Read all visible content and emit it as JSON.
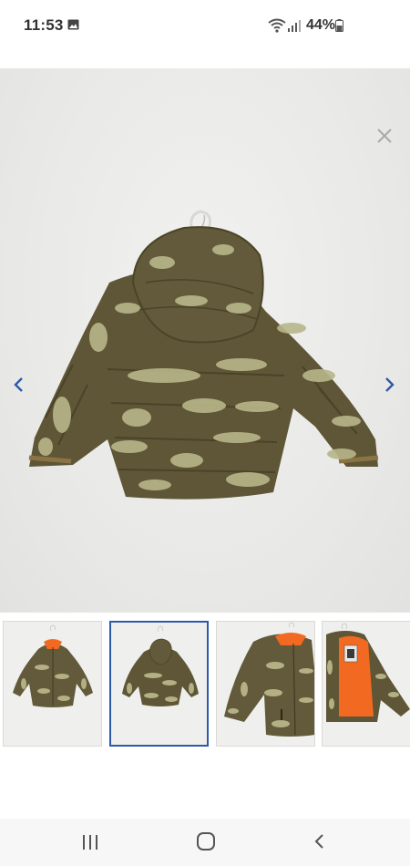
{
  "status_bar": {
    "time": "11:53",
    "battery": "44%",
    "icons": [
      "gallery-icon",
      "wifi-icon",
      "signal-icon",
      "battery-icon"
    ]
  },
  "viewer": {
    "close_icon": "close-icon",
    "prev_icon": "chevron-left-icon",
    "next_icon": "chevron-right-icon",
    "image": "dinosaur-print-puffer-jacket-back-view",
    "colors": {
      "jacket": "#5e5636",
      "print": "#b8b68a",
      "lining": "#f26a21",
      "accent": "#2d5aa8"
    }
  },
  "thumbnails": [
    {
      "image": "jacket-front-view",
      "selected": false
    },
    {
      "image": "jacket-back-view",
      "selected": true
    },
    {
      "image": "jacket-front-angle-view",
      "selected": false
    },
    {
      "image": "jacket-open-lining-view",
      "selected": false
    }
  ],
  "nav_bar": {
    "icons": [
      "recents-icon",
      "home-icon",
      "back-icon"
    ]
  }
}
